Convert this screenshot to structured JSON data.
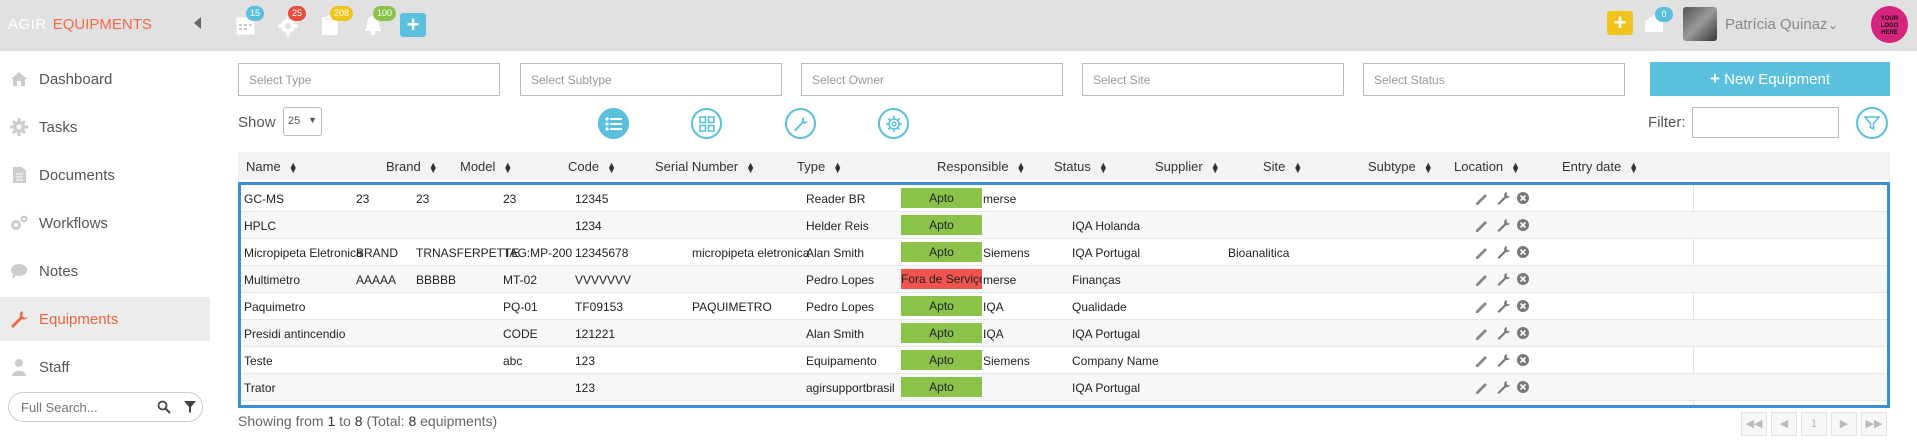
{
  "app": {
    "brand_agir": "AGIR",
    "brand_module": "EQUIPMENTS"
  },
  "topbar": {
    "badges": [
      {
        "icon": "calendar-icon",
        "count": "15",
        "color": "#5bc0de"
      },
      {
        "icon": "gear-icon",
        "count": "25",
        "color": "#e74c3c"
      },
      {
        "icon": "clipboard-icon",
        "count": "208",
        "color": "#f0c419"
      },
      {
        "icon": "bell-icon",
        "count": "100",
        "color": "#8bc34a"
      }
    ],
    "right_badge": "0",
    "user_name": "Patrícia Quinaz",
    "logo_text": "YOUR LOGO HERE"
  },
  "sidebar": {
    "items": [
      {
        "label": "Dashboard",
        "icon": "home-icon"
      },
      {
        "label": "Tasks",
        "icon": "gear-icon"
      },
      {
        "label": "Documents",
        "icon": "document-icon"
      },
      {
        "label": "Workflows",
        "icon": "gears-icon"
      },
      {
        "label": "Notes",
        "icon": "chat-icon"
      },
      {
        "label": "Equipments",
        "icon": "wrench-icon",
        "active": true
      },
      {
        "label": "Staff",
        "icon": "user-icon"
      }
    ],
    "search_placeholder": "Full Search..."
  },
  "filters": {
    "type": "Select Type",
    "subtype": "Select Subtype",
    "owner": "Select Owner",
    "site": "Select Site",
    "status": "Select Status",
    "new_button": "New Equipment"
  },
  "controls": {
    "show_label": "Show",
    "show_value": "25",
    "filter_label": "Filter:"
  },
  "table": {
    "columns": [
      "Name",
      "Brand",
      "Model",
      "Code",
      "Serial Number",
      "Type",
      "Responsible",
      "Status",
      "Supplier",
      "Site",
      "Subtype",
      "Location",
      "Entry date"
    ],
    "rows": [
      {
        "name": "GC-MS",
        "brand": "23",
        "model": "23",
        "code": "23",
        "serial": "12345",
        "type": "",
        "responsible": "Reader BR",
        "status": "Apto",
        "supplier": "merse",
        "site": "",
        "subtype": "",
        "location": "",
        "entry": ""
      },
      {
        "name": "HPLC",
        "brand": "",
        "model": "",
        "code": "",
        "serial": "1234",
        "type": "",
        "responsible": "Helder Reis",
        "status": "Apto",
        "supplier": "",
        "site": "IQA Holanda",
        "subtype": "",
        "location": "",
        "entry": ""
      },
      {
        "name": "Micropipeta Eletronica",
        "brand": "BRAND",
        "model": "TRNASFERPETTE",
        "code": "TAG:MP-200",
        "serial": "12345678",
        "type": "micropipeta eletronica",
        "responsible": "Alan Smith",
        "status": "Apto",
        "supplier": "Siemens",
        "site": "IQA Portugal",
        "subtype": "",
        "location": "Bioanalitica",
        "entry": ""
      },
      {
        "name": "Multimetro",
        "brand": "AAAAA",
        "model": "BBBBB",
        "code": "MT-02",
        "serial": "VVVVVVV",
        "type": "",
        "responsible": "Pedro Lopes",
        "status": "Fora de Serviço",
        "supplier": "merse",
        "site": "Finanças",
        "subtype": "",
        "location": "",
        "entry": ""
      },
      {
        "name": "Paquimetro",
        "brand": "",
        "model": "",
        "code": "PQ-01",
        "serial": "TF09153",
        "type": "PAQUIMETRO",
        "responsible": "Pedro Lopes",
        "status": "Apto",
        "supplier": "IQA",
        "site": "Qualidade",
        "subtype": "",
        "location": "",
        "entry": ""
      },
      {
        "name": "Presidi antincendio",
        "brand": "",
        "model": "",
        "code": "CODE",
        "serial": "121221",
        "type": "",
        "responsible": "Alan Smith",
        "status": "Apto",
        "supplier": "IQA",
        "site": "IQA Portugal",
        "subtype": "",
        "location": "",
        "entry": ""
      },
      {
        "name": "Teste",
        "brand": "",
        "model": "",
        "code": "abc",
        "serial": "123",
        "type": "",
        "responsible": "Equipamento",
        "status": "Apto",
        "supplier": "Siemens",
        "site": "Company Name",
        "subtype": "",
        "location": "",
        "entry": ""
      },
      {
        "name": "Trator",
        "brand": "",
        "model": "",
        "code": "",
        "serial": "123",
        "type": "",
        "responsible": "agirsupportbrasil",
        "status": "Apto",
        "supplier": "",
        "site": "IQA Portugal",
        "subtype": "",
        "location": "",
        "entry": ""
      }
    ]
  },
  "status_colors": {
    "Apto": "#8bc34a",
    "Fora de Serviço": "#f0544f"
  },
  "footer": {
    "prefix": "Showing from",
    "from": "1",
    "to_word": "to",
    "to": "8",
    "total_prefix": "(Total:",
    "total": "8",
    "total_suffix": "equipments)"
  },
  "pagination": {
    "current_page": "1"
  }
}
